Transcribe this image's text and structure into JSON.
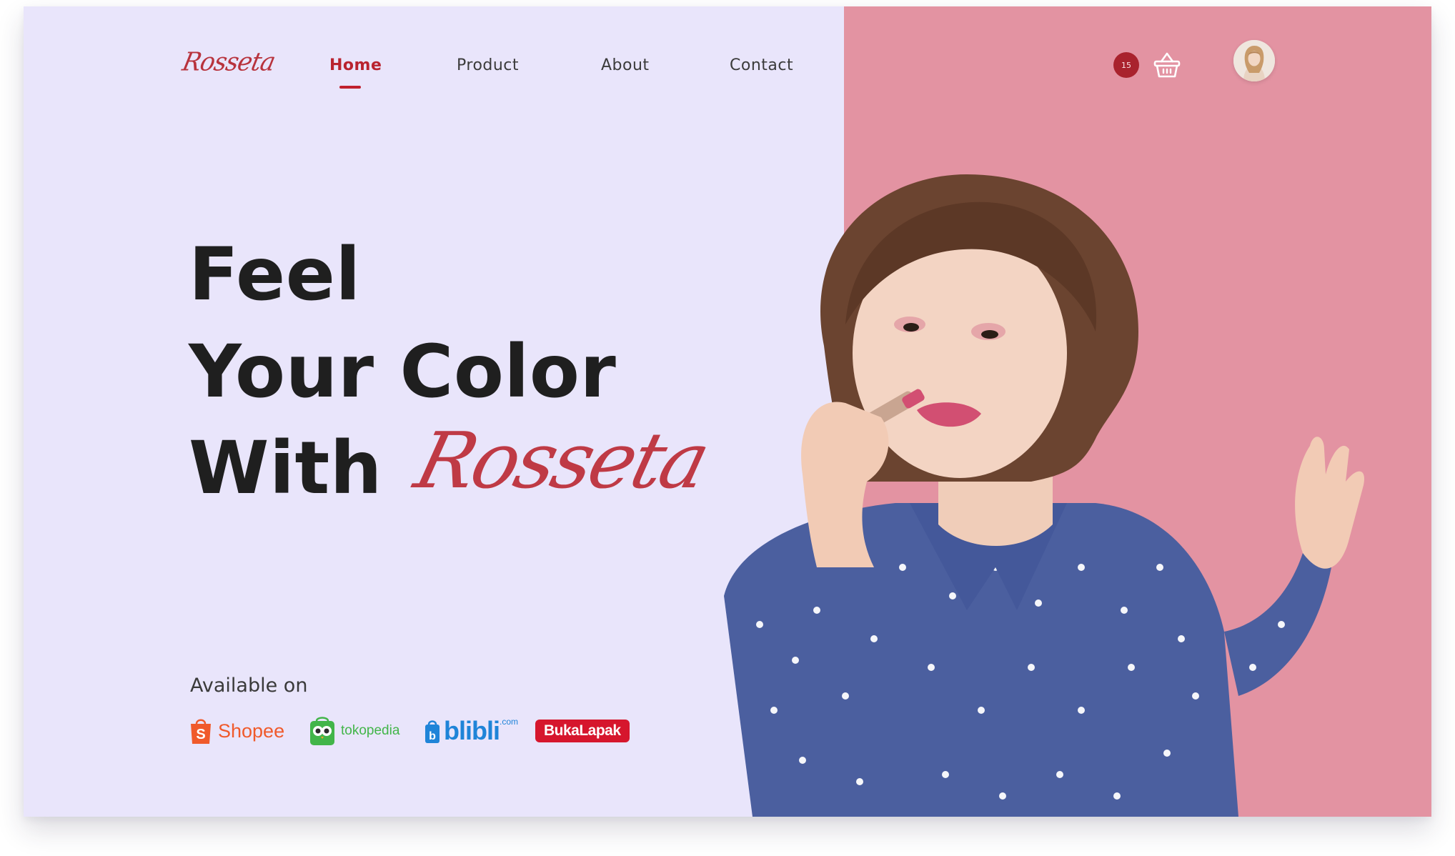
{
  "brand": {
    "logo_text": "Rosseta"
  },
  "nav": {
    "links": [
      {
        "label": "Home",
        "active": true
      },
      {
        "label": "Product",
        "active": false
      },
      {
        "label": "About",
        "active": false
      },
      {
        "label": "Contact",
        "active": false
      }
    ],
    "cart_count": "15",
    "avatar_icon": "user-avatar-icon",
    "cart_icon": "shopping-basket-icon"
  },
  "hero": {
    "line1": "Feel",
    "line2": "Your Color",
    "line3": "With",
    "script": "Rosseta",
    "available_on": "Available on",
    "stores": [
      {
        "name": "Shopee",
        "icon": "shopee-bag-icon"
      },
      {
        "name": "tokopedia",
        "icon": "tokopedia-owl-icon"
      },
      {
        "name": "blibli",
        "suffix": ".com",
        "icon": "blibli-bag-icon"
      },
      {
        "name": "BukaLapak",
        "icon": "bukalapak-logo"
      }
    ]
  },
  "colors": {
    "background": "#e9e5fb",
    "panel_pink": "#e393a2",
    "accent_red": "#b9232f",
    "heading": "#1f1f1f"
  }
}
